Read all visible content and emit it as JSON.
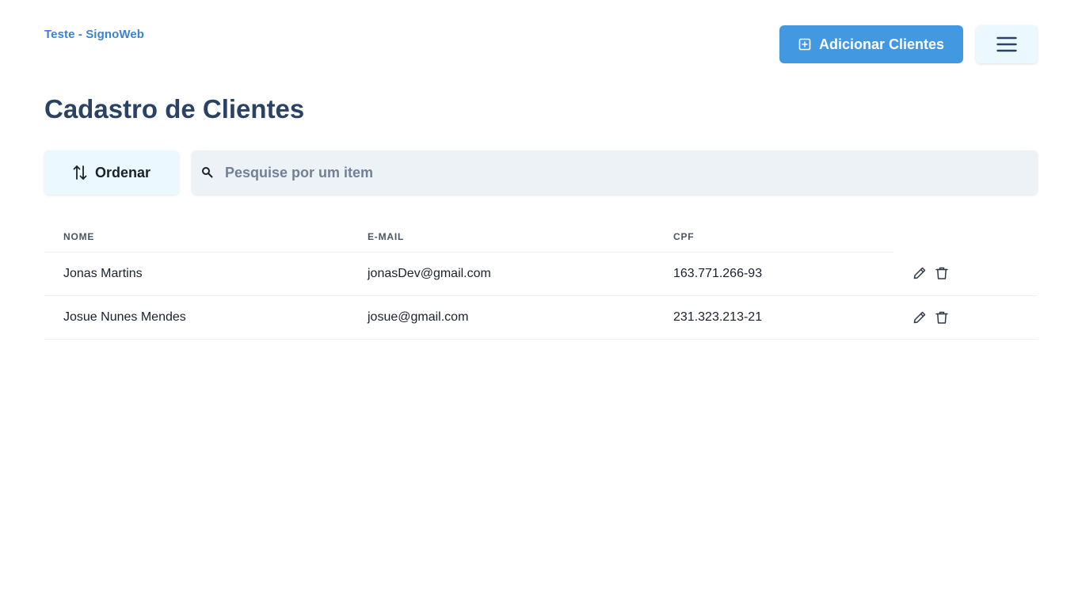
{
  "brand": "Teste - SignoWeb",
  "header": {
    "add_button_label": "Adicionar Clientes",
    "add_icon": "plus-square-icon",
    "menu_icon": "hamburger-menu-icon"
  },
  "page_title": "Cadastro de Clientes",
  "toolbar": {
    "sort_label": "Ordenar",
    "sort_icon": "sort-arrows-icon",
    "search_icon": "search-icon",
    "search_placeholder": "Pesquise por um item",
    "search_value": ""
  },
  "table": {
    "columns": [
      "NOME",
      "E-MAIL",
      "CPF"
    ],
    "rows": [
      {
        "name": "Jonas Martins",
        "email": "jonasDev@gmail.com",
        "cpf": "163.771.266-93"
      },
      {
        "name": "Josue Nunes Mendes",
        "email": "josue@gmail.com",
        "cpf": "231.323.213-21"
      }
    ],
    "row_actions": [
      "edit-icon",
      "trash-icon"
    ]
  },
  "colors": {
    "brand": "#3b82d6",
    "primary_button": "#4299e1",
    "title": "#2a4365",
    "light_button": "#ebf8ff",
    "search_bg": "#edf2f7"
  }
}
